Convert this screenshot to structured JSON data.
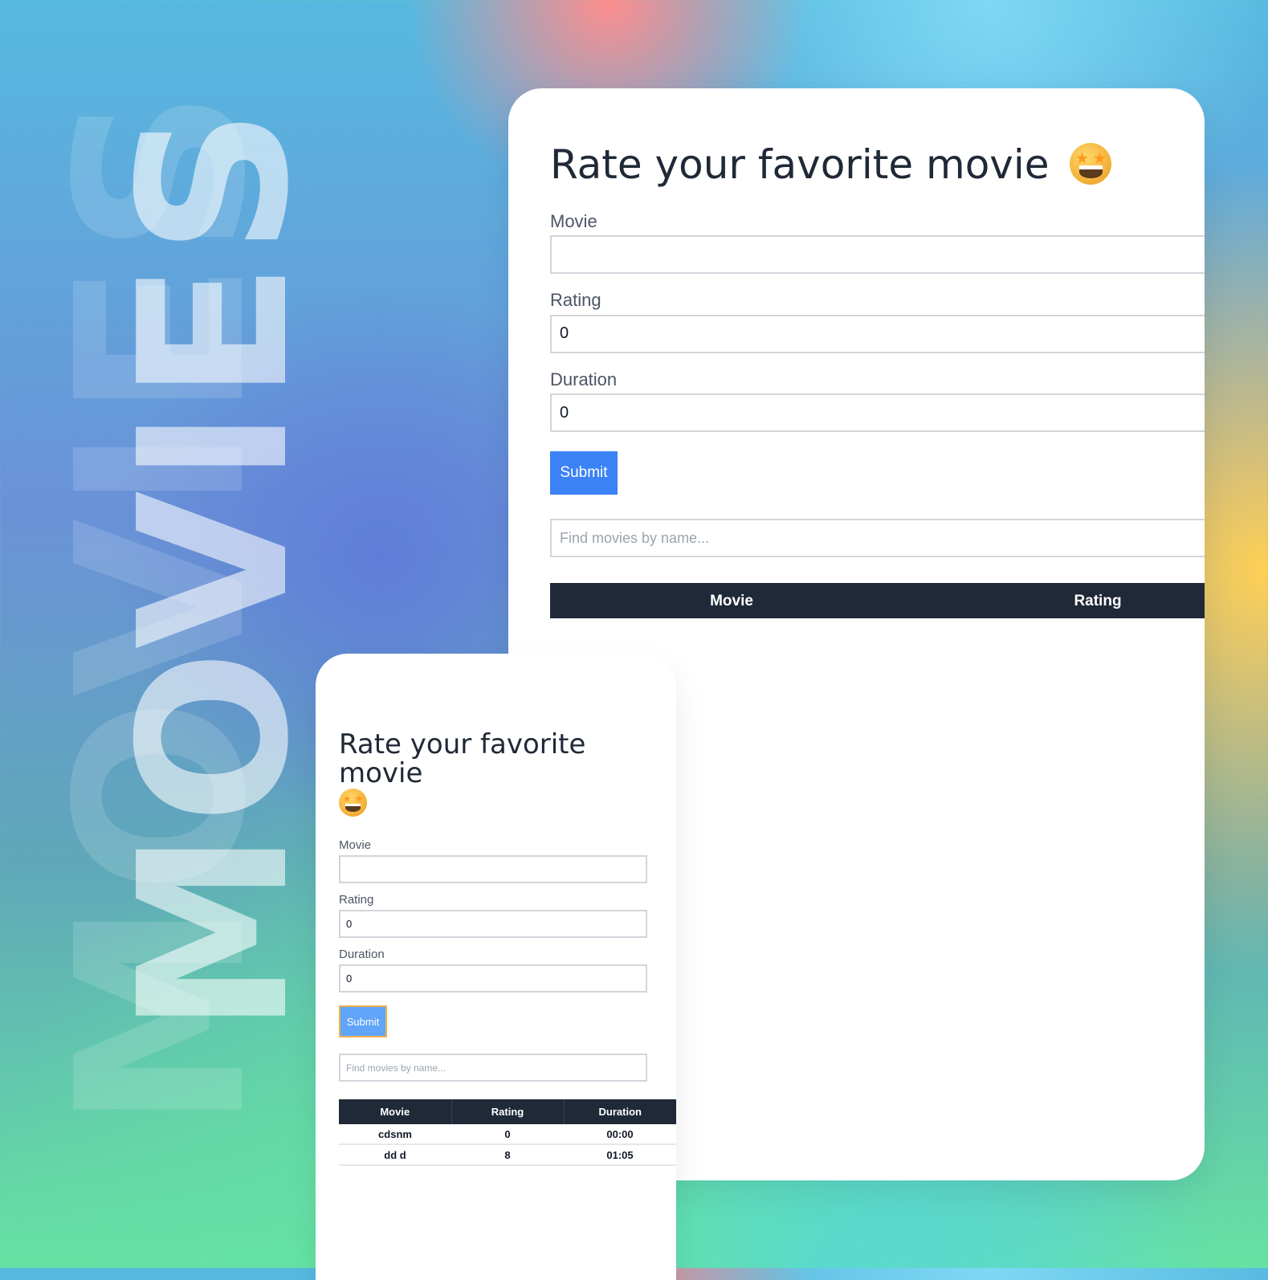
{
  "background": {
    "word": "MOVIES"
  },
  "desktop": {
    "title": "Rate your favorite movie",
    "form": {
      "movie_label": "Movie",
      "movie_value": "",
      "rating_label": "Rating",
      "rating_value": "0",
      "duration_label": "Duration",
      "duration_value": "0",
      "submit_label": "Submit"
    },
    "search": {
      "placeholder": "Find movies by name..."
    },
    "table": {
      "headers": [
        "Movie",
        "Rating"
      ]
    }
  },
  "mobile": {
    "title": "Rate your favorite movie",
    "form": {
      "movie_label": "Movie",
      "movie_value": "",
      "rating_label": "Rating",
      "rating_value": "0",
      "duration_label": "Duration",
      "duration_value": "0",
      "submit_label": "Submit"
    },
    "search": {
      "placeholder": "Find movies by name..."
    },
    "table": {
      "headers": [
        "Movie",
        "Rating",
        "Duration"
      ],
      "rows": [
        {
          "movie": "cdsnm",
          "rating": "0",
          "duration": "00:00"
        },
        {
          "movie": "dd d",
          "rating": "8",
          "duration": "01:05"
        }
      ]
    }
  },
  "colors": {
    "primary": "#3b82f6",
    "dark_header": "#1f2937",
    "text_dark": "#1f2937",
    "text_muted": "#4b5563"
  },
  "icons": {
    "title_emoji": "star-struck-emoji-icon"
  }
}
